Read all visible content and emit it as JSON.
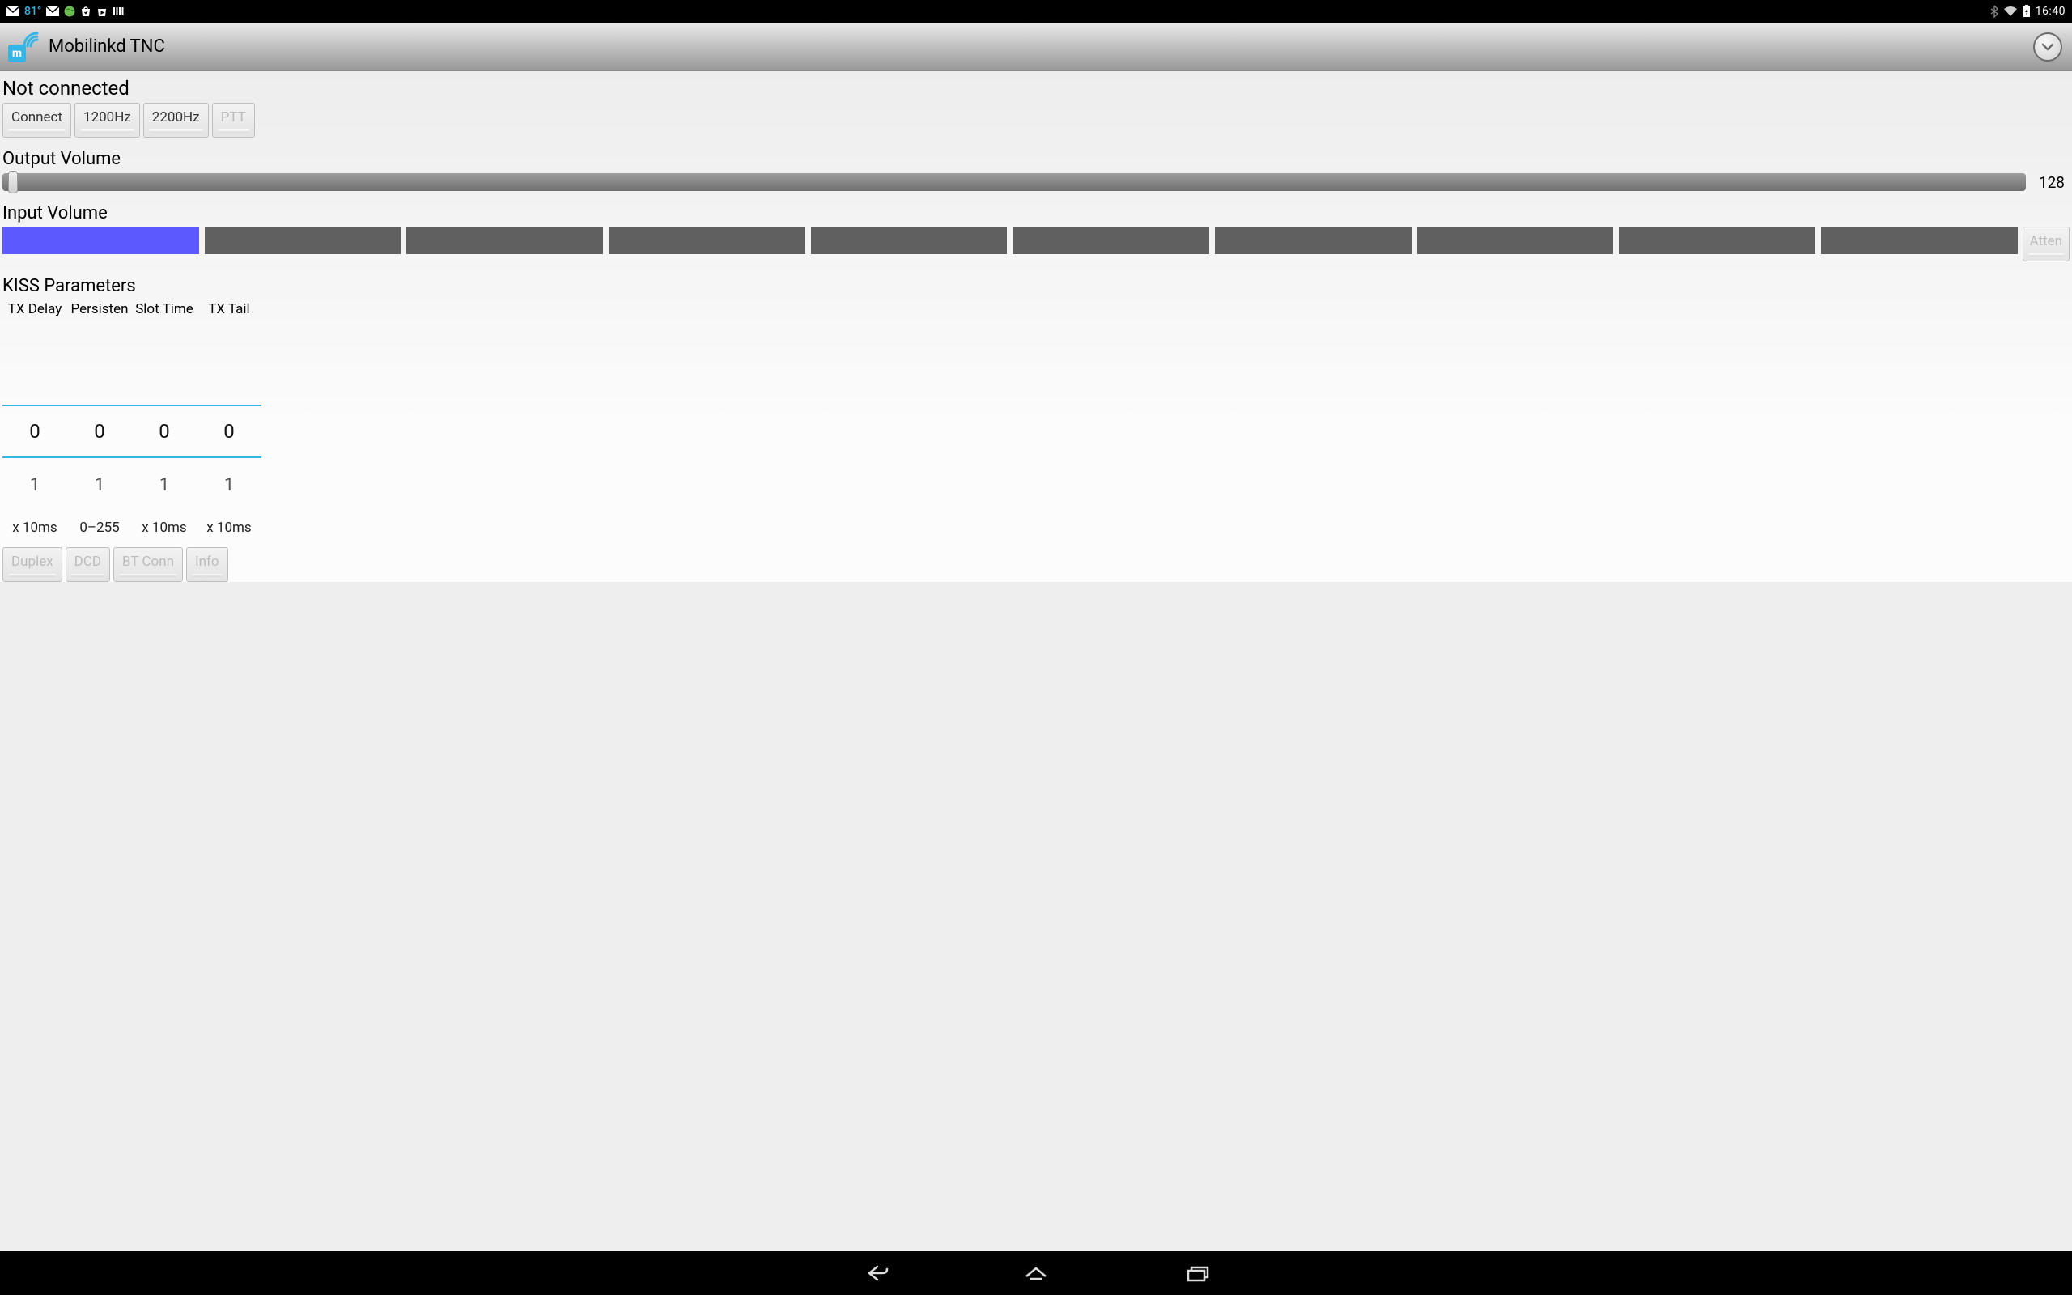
{
  "status_bar": {
    "temperature": "81°",
    "clock": "16:40"
  },
  "action_bar": {
    "title": "Mobilinkd TNC"
  },
  "main": {
    "connection_status": "Not connected",
    "buttons": {
      "connect": "Connect",
      "tone1": "1200Hz",
      "tone2": "2200Hz",
      "ptt": "PTT"
    },
    "output_volume": {
      "label": "Output Volume",
      "value": "128",
      "min": 0,
      "max": 255,
      "position": 0
    },
    "input_volume": {
      "label": "Input Volume",
      "segments": 10,
      "active": 1,
      "atten_label": "Atten"
    },
    "kiss": {
      "label": "KISS Parameters",
      "columns": [
        {
          "header": "TX Delay",
          "prev": "",
          "value": "0",
          "next": "1",
          "unit": "x 10ms"
        },
        {
          "header": "Persisten",
          "prev": "",
          "value": "0",
          "next": "1",
          "unit": "0–255"
        },
        {
          "header": "Slot Time",
          "prev": "",
          "value": "0",
          "next": "1",
          "unit": "x 10ms"
        },
        {
          "header": "TX Tail",
          "prev": "",
          "value": "0",
          "next": "1",
          "unit": "x 10ms"
        }
      ]
    },
    "bottom_buttons": {
      "duplex": "Duplex",
      "dcd": "DCD",
      "btconn": "BT Conn",
      "info": "Info"
    }
  }
}
